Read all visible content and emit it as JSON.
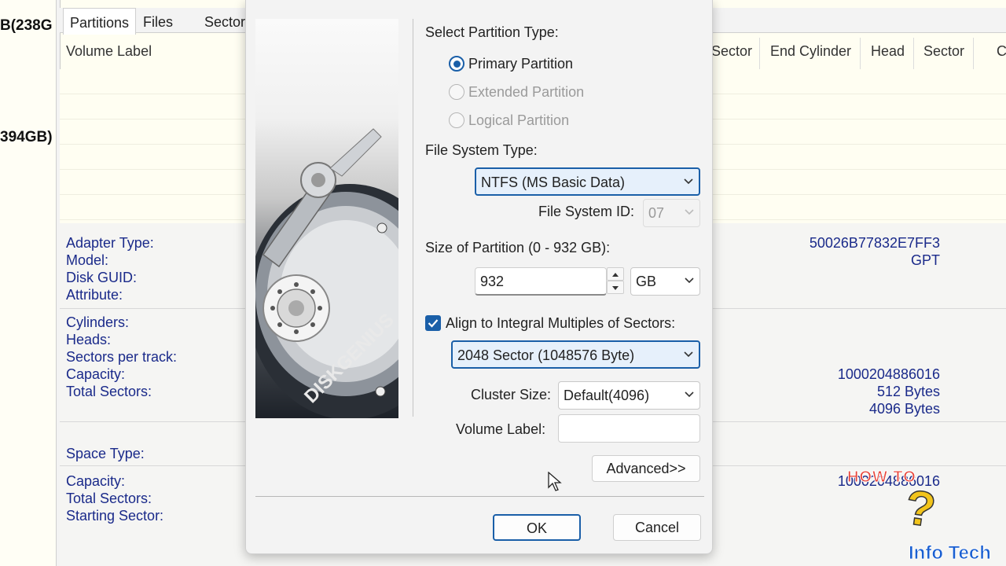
{
  "background": {
    "disk_labels": [
      "B(238G",
      "394GB)"
    ],
    "tabs": [
      "Partitions",
      "Files",
      "Sector"
    ],
    "column_headers": {
      "volume_label": "Volume Label",
      "sector1": "Sector",
      "end_cylinder": "End Cylinder",
      "head": "Head",
      "sector2": "Sector",
      "c": "C"
    },
    "disk_info": {
      "adapter_type": "Adapter Type:",
      "model": "Model:",
      "disk_guid": "Disk GUID:",
      "attribute": "Attribute:",
      "guid_value": "50026B77832E7FF3",
      "gpt_value": "GPT",
      "cylinders": "Cylinders:",
      "heads": "Heads:",
      "sectors_per_track": "Sectors per track:",
      "capacity": "Capacity:",
      "total_sectors": "Total Sectors:",
      "capacity_value": "1000204886016",
      "bytes512": "512 Bytes",
      "bytes4096": "4096 Bytes",
      "space_type": "Space Type:",
      "capacity2": "Capacity:",
      "total_sectors2": "Total Sectors:",
      "starting_sector": "Starting Sector:",
      "capacity2_value": "1000204886016"
    }
  },
  "dialog": {
    "banner_text": "DISKGENIUS",
    "select_type_label": "Select Partition Type:",
    "primary_label": "Primary Partition",
    "extended_label": "Extended Partition",
    "logical_label": "Logical Partition",
    "fs_type_label": "File System Type:",
    "fs_type_value": "NTFS (MS Basic Data)",
    "fs_id_label": "File System ID:",
    "fs_id_value": "07",
    "size_label": "Size of Partition (0 - 932 GB):",
    "size_value": "932",
    "size_unit": "GB",
    "align_label": "Align to Integral Multiples of Sectors:",
    "align_checked": true,
    "align_value": "2048 Sector (1048576 Byte)",
    "cluster_label": "Cluster Size:",
    "cluster_value": "Default(4096)",
    "volume_label": "Volume Label:",
    "volume_value": "",
    "advanced_button": "Advanced>>",
    "ok_button": "OK",
    "cancel_button": "Cancel"
  },
  "watermark": {
    "how_to": "HOW TO",
    "question": "?",
    "info_tech": "Info Tech"
  },
  "colors": {
    "accent": "#1a5fa8",
    "info_text": "#1a2a8a",
    "background": "#fffef2"
  }
}
